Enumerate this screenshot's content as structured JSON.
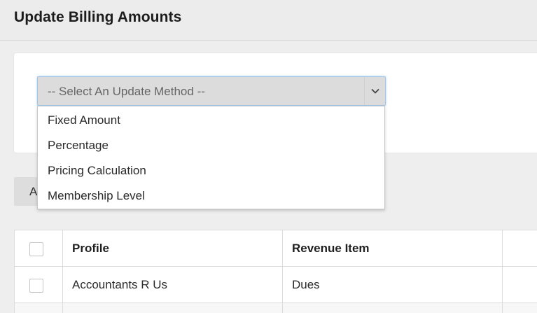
{
  "header": {
    "title": "Update Billing Amounts"
  },
  "update_method": {
    "placeholder": "-- Select An Update Method --",
    "options": [
      {
        "label": "Fixed Amount"
      },
      {
        "label": "Percentage"
      },
      {
        "label": "Pricing Calculation"
      },
      {
        "label": "Membership Level"
      }
    ]
  },
  "action_button": {
    "label": "A"
  },
  "table": {
    "columns": [
      "Profile",
      "Revenue Item"
    ],
    "rows": [
      {
        "profile": "Accountants R Us",
        "revenue_item": "Dues"
      }
    ]
  },
  "colors": {
    "header_bg": "#ececec",
    "page_bg": "#eeeeee",
    "select_focus_border": "#9fc6e8"
  },
  "icons": {
    "select_caret": "chevron-down-icon"
  }
}
